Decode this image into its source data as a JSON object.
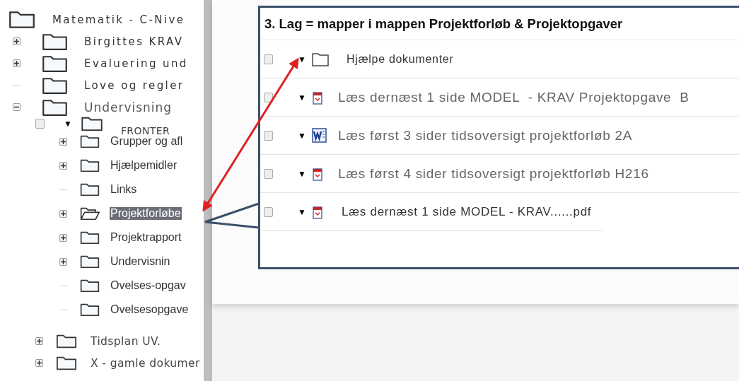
{
  "tree": {
    "label": "Matematik - C-Nive",
    "selected": false,
    "children": [
      {
        "label": "Birgittes KRAV",
        "expanded": false,
        "selected": false
      },
      {
        "label": "Evaluering und",
        "expanded": false,
        "selected": false
      },
      {
        "label": "Love og regler",
        "selected": false
      },
      {
        "label": "Undervisning",
        "expanded": true,
        "selected": false,
        "children": [
          {
            "label": "FRONTER",
            "checked": false,
            "toggle": "▼",
            "selected": false,
            "children": [
              {
                "label": "Grupper og afl",
                "expanded": false,
                "selected": false
              },
              {
                "label": "Hjælpemidler",
                "expanded": false,
                "selected": false
              },
              {
                "label": "Links",
                "selected": false
              },
              {
                "label": "Projektforløbe",
                "expanded": false,
                "selected": true
              },
              {
                "label": "Projektrapport",
                "expanded": false,
                "selected": false
              },
              {
                "label": "Undervisnin",
                "expanded": false,
                "selected": false
              },
              {
                "label": "Ovelses-opgav",
                "selected": false
              },
              {
                "label": "Ovelsesopgave",
                "selected": false
              }
            ]
          },
          {
            "label": "Tidsplan UV.",
            "expanded": false,
            "selected": false
          },
          {
            "label": "X - gamle dokumer",
            "expanded": false,
            "selected": false
          }
        ]
      }
    ]
  },
  "callout": {
    "title": "3. Lag = mapper i mappen Projektforløb & Projektopgaver",
    "rows": [
      {
        "checked": false,
        "toggle": "▼",
        "kind": "folder",
        "name": "Hjælpe dokumenter"
      },
      {
        "checked": false,
        "toggle": "▼",
        "kind": "pdf",
        "name": "Læs dernæst 1 side MODEL  - KRAV Projektopgave  B"
      },
      {
        "checked": false,
        "toggle": "▼",
        "kind": "word",
        "name": "Læs først 3 sider tidsoversigt projektforløb 2A"
      },
      {
        "checked": false,
        "toggle": "▼",
        "kind": "pdf",
        "name": "Læs først 4 sider tidsoversigt projektforløb H216"
      },
      {
        "checked": false,
        "toggle": "▼",
        "kind": "pdf",
        "name": "Læs dernæst 1 side MODEL - KRAV......pdf"
      }
    ]
  }
}
